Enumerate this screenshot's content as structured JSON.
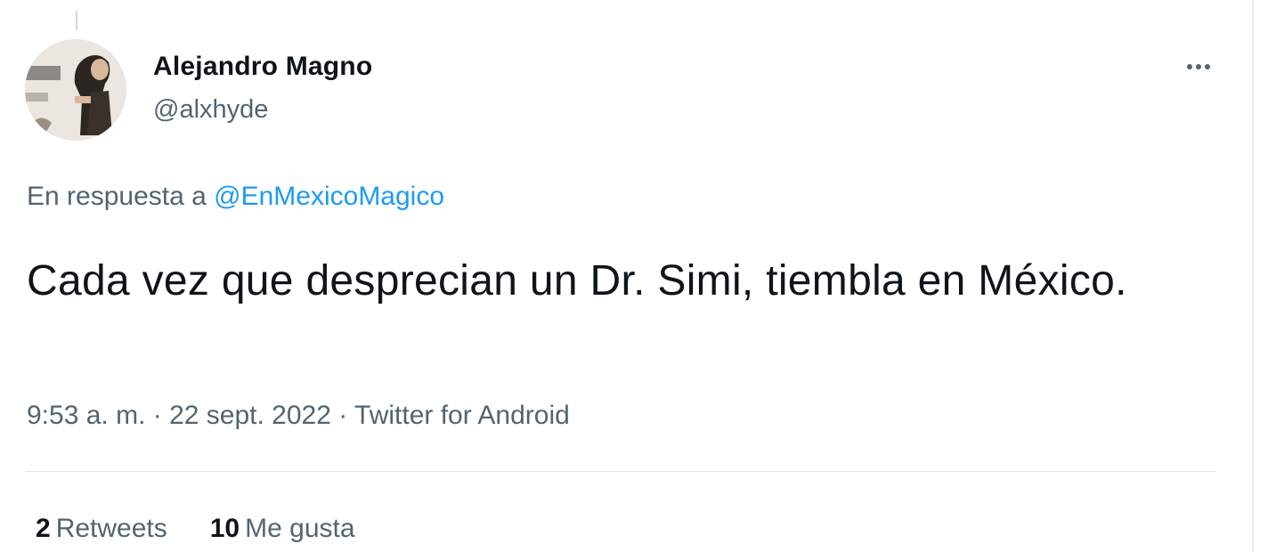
{
  "author": {
    "name": "Alejandro Magno",
    "handle": "@alxhyde"
  },
  "more_menu": {
    "icon": "more-horizontal-icon"
  },
  "reply": {
    "prefix": "En respuesta a",
    "mention": "@EnMexicoMagico"
  },
  "tweet": {
    "text": "Cada vez que desprecian un Dr. Simi, tiembla en México."
  },
  "meta": {
    "time": "9:53 a. m.",
    "separator_1": " · ",
    "date": "22 sept. 2022",
    "separator_2": " · ",
    "source": "Twitter for Android"
  },
  "stats": {
    "retweets_count": "2",
    "retweets_label": "Retweets",
    "likes_count": "10",
    "likes_label": "Me gusta"
  },
  "colors": {
    "text_primary": "#0f1419",
    "text_secondary": "#536471",
    "link": "#1d9bf0",
    "divider": "#e1e6ea"
  }
}
